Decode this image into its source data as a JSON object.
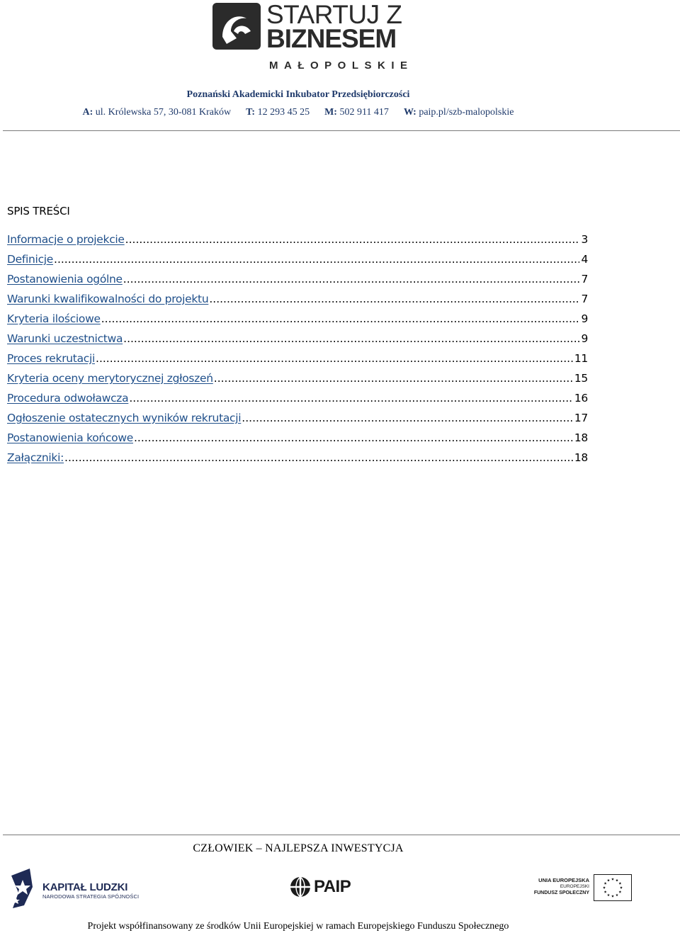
{
  "header": {
    "logo": {
      "line1": "STARTUJ Z",
      "line2": "BIZNESEM",
      "sub": "MAŁOPOLSKIE"
    },
    "org_name": "Poznański Akademicki Inkubator Przedsiębiorczości",
    "contact": {
      "address_label": "A:",
      "address": "ul. Królewska 57, 30-081 Kraków",
      "phone_label": "T:",
      "phone": "12 293 45 25",
      "mobile_label": "M:",
      "mobile": "502 911 417",
      "web_label": "W:",
      "web": "paip.pl/szb-malopolskie"
    }
  },
  "toc": {
    "title": "SPIS TREŚCI",
    "items": [
      {
        "label": "Informacje o projekcie",
        "page": "3"
      },
      {
        "label": "Definicje",
        "page": "4"
      },
      {
        "label": "Postanowienia ogólne",
        "page": "7"
      },
      {
        "label": "Warunki kwalifikowalności do projektu",
        "page": "7"
      },
      {
        "label": "Kryteria ilościowe",
        "page": "9"
      },
      {
        "label": "Warunki uczestnictwa",
        "page": "9"
      },
      {
        "label": "Proces rekrutacji",
        "page": "11"
      },
      {
        "label": "Kryteria oceny merytorycznej zgłoszeń",
        "page": "15"
      },
      {
        "label": "Procedura odwoławcza",
        "page": "16"
      },
      {
        "label": "Ogłoszenie ostatecznych wyników rekrutacji",
        "page": "17"
      },
      {
        "label": "Postanowienia końcowe",
        "page": "18"
      },
      {
        "label": "Załączniki:",
        "page": "18"
      }
    ]
  },
  "footer": {
    "slogan": "CZŁOWIEK – NAJLEPSZA INWESTYCJA",
    "kapital_ludzki": {
      "title": "KAPITAŁ LUDZKI",
      "subtitle": "NARODOWA STRATEGIA SPÓJNOŚCI"
    },
    "paip": "PAIP",
    "eu": {
      "line1": "UNIA EUROPEJSKA",
      "line2": "EUROPEJSKI",
      "line3": "FUNDUSZ SPOŁECZNY"
    },
    "cofinance": "Projekt współfinansowany ze środków Unii Europejskiej w ramach Europejskiego Funduszu Społecznego"
  },
  "colors": {
    "link": "#1f4f8a",
    "header_text": "#1f3a6b",
    "logo_dark": "#2b2b2b",
    "eu_blue": "#1e2a55"
  }
}
